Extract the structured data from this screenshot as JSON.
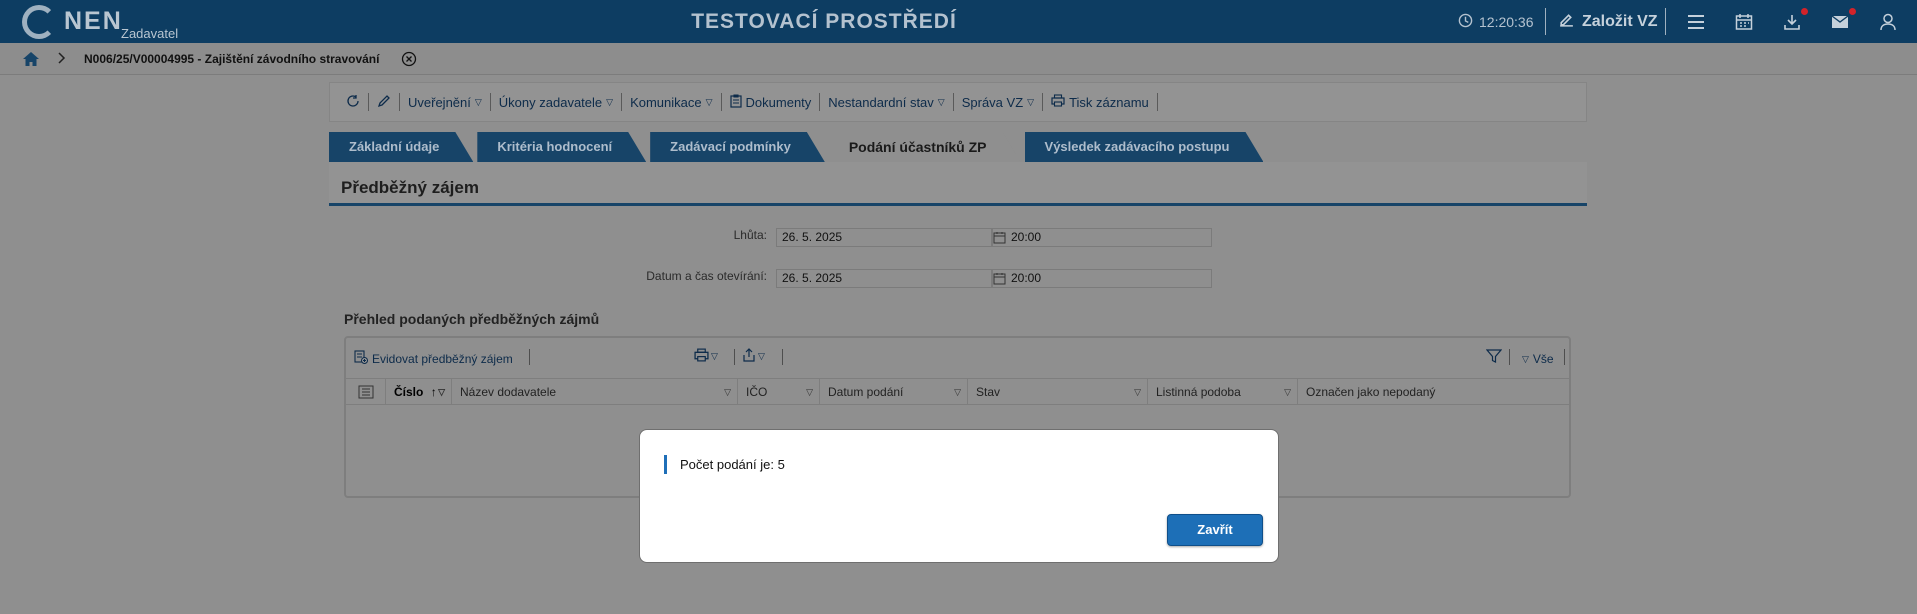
{
  "header": {
    "logo_text": "NEN",
    "logo_sub": "Zadavatel",
    "environment": "TESTOVACÍ PROSTŘEDÍ",
    "clock": "12:20:36",
    "create_label": "Založit VZ",
    "icons": [
      "menu-icon",
      "calendar-icon",
      "download-icon",
      "mail-icon",
      "user-icon"
    ]
  },
  "breadcrumb": {
    "title": "N006/25/V00004995 - Zajištění závodního stravování"
  },
  "toolbar": {
    "items": [
      "Uveřejnění",
      "Úkony zadavatele",
      "Komunikace",
      "Dokumenty",
      "Nestandardní stav",
      "Správa VZ",
      "Tisk záznamu"
    ]
  },
  "tabs": [
    "Základní údaje",
    "Kritéria hodnocení",
    "Zadávací podmínky",
    "Podání účastníků ZP",
    "Výsledek zadávacího postupu"
  ],
  "active_tab": "Podání účastníků ZP",
  "section": {
    "title": "Předběžný zájem",
    "fields": [
      {
        "label": "Lhůta:",
        "date": "26. 5. 2025",
        "time": "20:00"
      },
      {
        "label": "Datum a čas otevírání:",
        "date": "26. 5. 2025",
        "time": "20:00"
      }
    ]
  },
  "grid": {
    "title": "Přehled podaných předběžných zájmů",
    "add_label": "Evidovat předběžný zájem",
    "filter_all": "Vše",
    "columns": [
      "Číslo",
      "Název dodavatele",
      "IČO",
      "Datum podání",
      "Stav",
      "Listinná podoba",
      "Označen jako nepodaný"
    ]
  },
  "modal": {
    "message": "Počet podání je: 5",
    "close_label": "Zavřít"
  },
  "colors": {
    "header_bg": "#0d3d62",
    "tab_bg": "#174468",
    "accent": "#1d6fb7"
  }
}
